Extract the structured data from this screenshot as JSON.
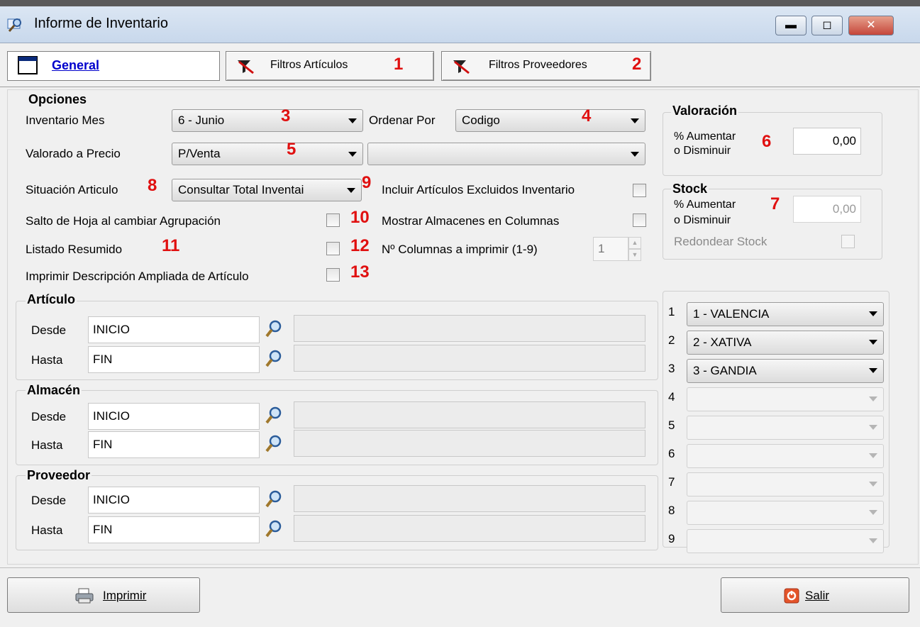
{
  "window": {
    "title": "Informe de Inventario",
    "min": "▬",
    "max": "◻",
    "close": "✕"
  },
  "tabs": {
    "general": "General",
    "filtros_articulos": "Filtros Artículos",
    "filtros_proveedores": "Filtros Proveedores"
  },
  "markers": [
    "1",
    "2",
    "3",
    "4",
    "5",
    "6",
    "7",
    "8",
    "9",
    "10",
    "11",
    "12",
    "13"
  ],
  "opciones": {
    "title": "Opciones",
    "inventario_mes_label": "Inventario Mes",
    "inventario_mes_value": "6  - Junio",
    "ordenar_por_label": "Ordenar Por",
    "ordenar_por_value": "Codigo",
    "valorado_label": "Valorado a Precio",
    "valorado_value": "P/Venta",
    "valorado_extra_value": "",
    "situacion_label": "Situación Articulo",
    "situacion_value": "Consultar Total Inventai",
    "incluir_excluidos_label": "Incluir Artículos Excluidos Inventario",
    "salto_hoja_label": "Salto de Hoja al cambiar Agrupación",
    "mostrar_almacenes_label": "Mostrar Almacenes en Columnas",
    "listado_resumido_label": "Listado Resumido",
    "num_columnas_label": "Nº Columnas a imprimir (1-9)",
    "num_columnas_value": "1",
    "imprimir_descripcion_label": "Imprimir Descripción Ampliada de Artículo"
  },
  "valoracion": {
    "title": "Valoración",
    "label1": "% Aumentar",
    "label2": "o Disminuir",
    "value": "0,00"
  },
  "stock": {
    "title": "Stock",
    "label1": "% Aumentar",
    "label2": "o Disminuir",
    "value": "0,00",
    "redondear_label": "Redondear Stock"
  },
  "articulo": {
    "title": "Artículo",
    "desde_label": "Desde",
    "desde_value": "INICIO",
    "hasta_label": "Hasta",
    "hasta_value": "FIN"
  },
  "almacen": {
    "title": "Almacén",
    "desde_label": "Desde",
    "desde_value": "INICIO",
    "hasta_label": "Hasta",
    "hasta_value": "FIN"
  },
  "proveedor": {
    "title": "Proveedor",
    "desde_label": "Desde",
    "desde_value": "INICIO",
    "hasta_label": "Hasta",
    "hasta_value": "FIN"
  },
  "almacenes_columnas": [
    {
      "num": "1",
      "value": "1 - VALENCIA"
    },
    {
      "num": "2",
      "value": "2 - XATIVA"
    },
    {
      "num": "3",
      "value": "3 - GANDIA"
    },
    {
      "num": "4",
      "value": ""
    },
    {
      "num": "5",
      "value": ""
    },
    {
      "num": "6",
      "value": ""
    },
    {
      "num": "7",
      "value": ""
    },
    {
      "num": "8",
      "value": ""
    },
    {
      "num": "9",
      "value": ""
    }
  ],
  "buttons": {
    "imprimir": "Imprimir",
    "salir": "Salir"
  }
}
